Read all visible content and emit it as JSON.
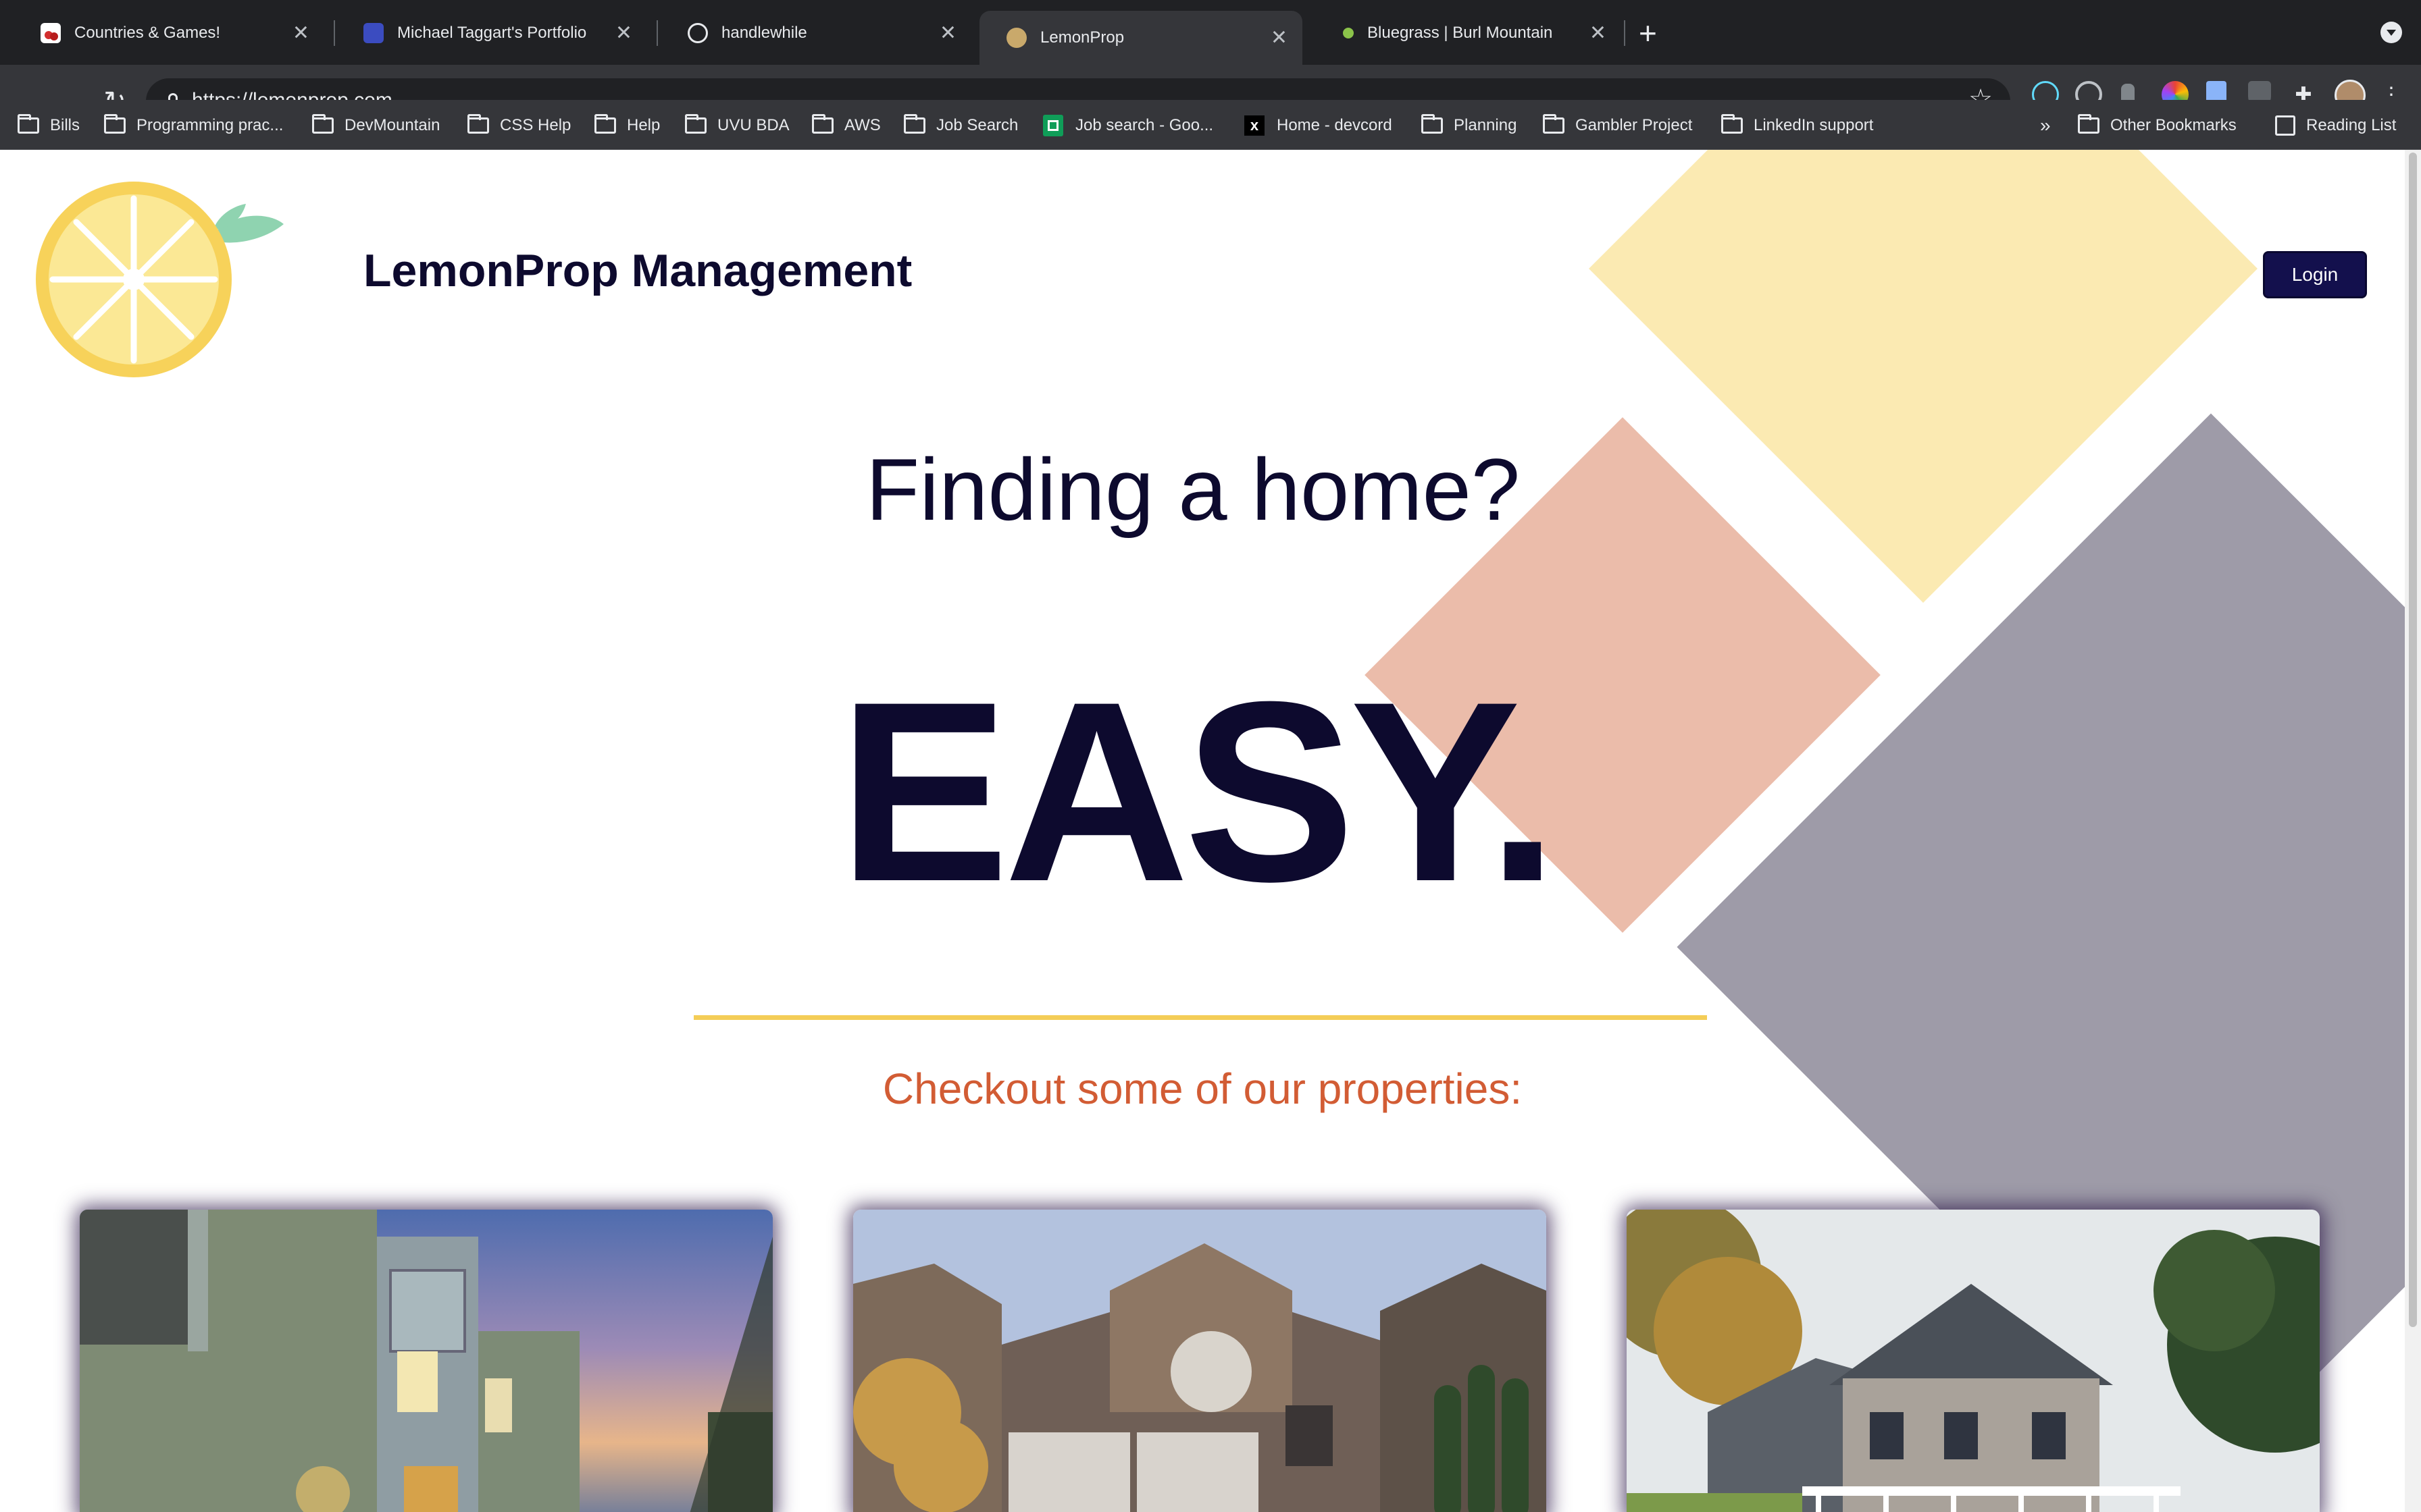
{
  "browser": {
    "tabs": [
      {
        "title": "Countries & Games!",
        "icon": "cherries-favicon",
        "active": false
      },
      {
        "title": "Michael Taggart's Portfolio",
        "icon": "portfolio-favicon",
        "active": false
      },
      {
        "title": "handlewhile",
        "icon": "globe-favicon",
        "active": false
      },
      {
        "title": "LemonProp",
        "icon": "lemon-favicon",
        "active": true
      },
      {
        "title": "Bluegrass | Burl Mountain",
        "icon": "mountain-favicon",
        "active": false
      }
    ],
    "url": "https://lemonprop.com",
    "bookmarks": [
      {
        "label": "Bills",
        "icon": "folder-icon"
      },
      {
        "label": "Programming prac...",
        "icon": "folder-icon"
      },
      {
        "label": "DevMountain",
        "icon": "folder-icon"
      },
      {
        "label": "CSS Help",
        "icon": "folder-icon"
      },
      {
        "label": "Help",
        "icon": "folder-icon"
      },
      {
        "label": "UVU BDA",
        "icon": "folder-icon"
      },
      {
        "label": "AWS",
        "icon": "folder-icon"
      },
      {
        "label": "Job Search",
        "icon": "folder-icon"
      },
      {
        "label": "Job search - Goo...",
        "icon": "sheets-icon"
      },
      {
        "label": "Home - devcord",
        "icon": "devcord-icon"
      },
      {
        "label": "Planning",
        "icon": "folder-icon"
      },
      {
        "label": "Gambler Project",
        "icon": "folder-icon"
      },
      {
        "label": "LinkedIn support",
        "icon": "folder-icon"
      }
    ],
    "overflow": "»",
    "other_bookmarks": "Other Bookmarks",
    "reading_list": "Reading List"
  },
  "site": {
    "brand": "LemonProp Management",
    "login_label": "Login",
    "headline": "Finding a home?",
    "emphasis": "EASY.",
    "subheading": "Checkout some of our properties:",
    "colors": {
      "navy": "#0d0a2e",
      "button": "#13104d",
      "accent_orange": "#d25c34",
      "divider_yellow": "#f4cd57",
      "diamond_yellow": "#fbeab2",
      "diamond_pink": "#ebbcaa",
      "diamond_gray": "#9e9ba8"
    },
    "properties": [
      {
        "image": "modern-townhouse-photo"
      },
      {
        "image": "brick-house-photo"
      },
      {
        "image": "shingle-house-photo"
      }
    ]
  }
}
